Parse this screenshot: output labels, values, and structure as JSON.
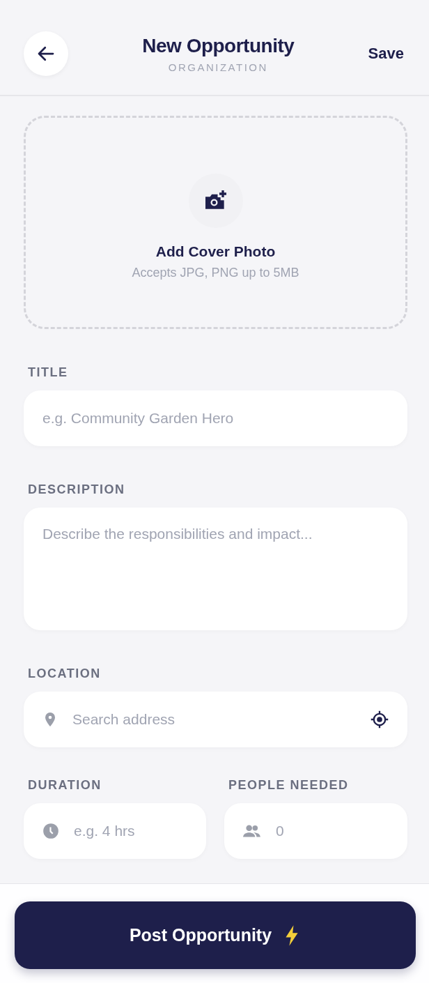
{
  "header": {
    "title": "New Opportunity",
    "subtitle": "ORGANIZATION",
    "action": "Save"
  },
  "cover": {
    "title": "Add Cover Photo",
    "hint": "Accepts JPG, PNG up to 5MB"
  },
  "fields": [
    {
      "kind": "text",
      "label": "TITLE",
      "placeholder": "e.g. Community Garden Hero"
    },
    {
      "kind": "textarea",
      "label": "DESCRIPTION",
      "placeholder": "Describe the responsibilities and impact..."
    },
    {
      "kind": "location",
      "label": "LOCATION",
      "placeholder": "Search address"
    }
  ],
  "pair": [
    {
      "kind": "duration",
      "label": "DURATION",
      "placeholder": "e.g. 4 hrs"
    },
    {
      "kind": "people",
      "label": "PEOPLE NEEDED",
      "placeholder": "0"
    }
  ],
  "submit": {
    "label": "Post Opportunity"
  }
}
